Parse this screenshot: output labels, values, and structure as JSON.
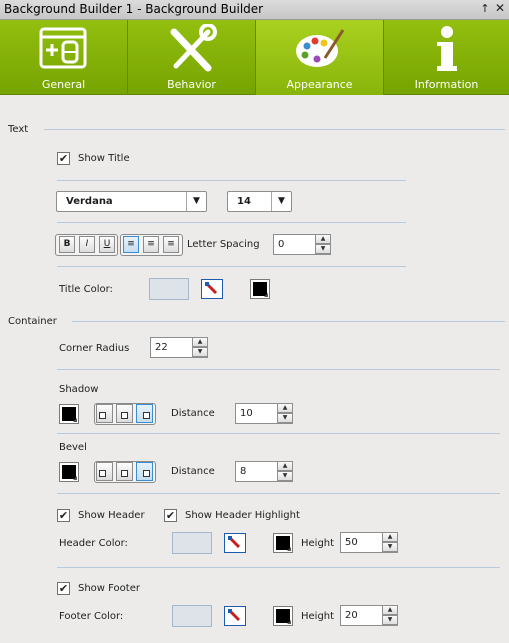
{
  "window": {
    "title": "Background Builder 1 - Background Builder",
    "pin_glyph": "↑",
    "close_glyph": "✕"
  },
  "tabs": [
    {
      "label": "General",
      "icon": "form-icon",
      "active": false
    },
    {
      "label": "Behavior",
      "icon": "tools-icon",
      "active": false
    },
    {
      "label": "Appearance",
      "icon": "palette-icon",
      "active": true
    },
    {
      "label": "Information",
      "icon": "info-icon",
      "active": false
    }
  ],
  "text_section": {
    "label": "Text",
    "show_title": {
      "label": "Show Title",
      "checked": true,
      "mark": "✔"
    },
    "font_family": {
      "value": "Verdana",
      "arrow": "▼"
    },
    "font_size": {
      "value": "14",
      "arrow": "▼"
    },
    "format_buttons": [
      "B",
      "I",
      "U"
    ],
    "align_buttons": [
      "≡",
      "≡",
      "≡"
    ],
    "letter_spacing": {
      "label": "Letter Spacing",
      "value": "0"
    },
    "title_color": {
      "label": "Title Color:"
    }
  },
  "container_section": {
    "label": "Container",
    "corner_radius": {
      "label": "Corner Radius",
      "value": "22"
    },
    "shadow": {
      "label": "Shadow",
      "distance_label": "Distance",
      "distance": "10"
    },
    "bevel": {
      "label": "Bevel",
      "distance_label": "Distance",
      "distance": "8"
    },
    "show_header": {
      "label": "Show Header",
      "checked": true,
      "mark": "✔"
    },
    "show_header_highlight": {
      "label": "Show Header Highlight",
      "checked": true,
      "mark": "✔"
    },
    "header_color": {
      "label": "Header Color:",
      "height_label": "Height",
      "height": "50"
    },
    "show_footer": {
      "label": "Show Footer",
      "checked": true,
      "mark": "✔"
    },
    "footer_color": {
      "label": "Footer Color:",
      "height_label": "Height",
      "height": "20"
    }
  },
  "spin_glyphs": {
    "up": "▲",
    "down": "▼"
  },
  "colors": {
    "accent_green": "#88b40a",
    "selection_blue": "#3a8dd2",
    "swatch": "#dee3e9",
    "black": "#000000"
  }
}
